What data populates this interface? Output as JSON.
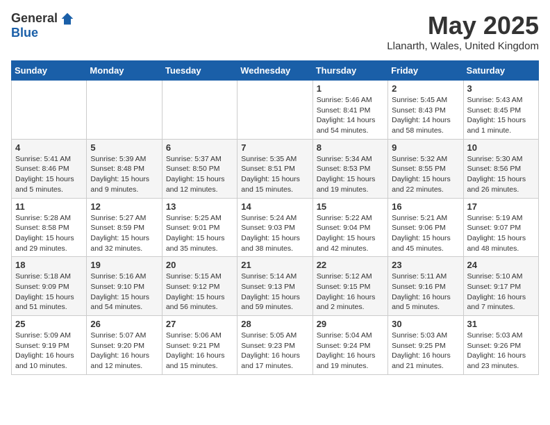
{
  "header": {
    "logo_general": "General",
    "logo_blue": "Blue",
    "month_title": "May 2025",
    "location": "Llanarth, Wales, United Kingdom"
  },
  "weekdays": [
    "Sunday",
    "Monday",
    "Tuesday",
    "Wednesday",
    "Thursday",
    "Friday",
    "Saturday"
  ],
  "weeks": [
    [
      {
        "day": "",
        "info": ""
      },
      {
        "day": "",
        "info": ""
      },
      {
        "day": "",
        "info": ""
      },
      {
        "day": "",
        "info": ""
      },
      {
        "day": "1",
        "info": "Sunrise: 5:46 AM\nSunset: 8:41 PM\nDaylight: 14 hours\nand 54 minutes."
      },
      {
        "day": "2",
        "info": "Sunrise: 5:45 AM\nSunset: 8:43 PM\nDaylight: 14 hours\nand 58 minutes."
      },
      {
        "day": "3",
        "info": "Sunrise: 5:43 AM\nSunset: 8:45 PM\nDaylight: 15 hours\nand 1 minute."
      }
    ],
    [
      {
        "day": "4",
        "info": "Sunrise: 5:41 AM\nSunset: 8:46 PM\nDaylight: 15 hours\nand 5 minutes."
      },
      {
        "day": "5",
        "info": "Sunrise: 5:39 AM\nSunset: 8:48 PM\nDaylight: 15 hours\nand 9 minutes."
      },
      {
        "day": "6",
        "info": "Sunrise: 5:37 AM\nSunset: 8:50 PM\nDaylight: 15 hours\nand 12 minutes."
      },
      {
        "day": "7",
        "info": "Sunrise: 5:35 AM\nSunset: 8:51 PM\nDaylight: 15 hours\nand 15 minutes."
      },
      {
        "day": "8",
        "info": "Sunrise: 5:34 AM\nSunset: 8:53 PM\nDaylight: 15 hours\nand 19 minutes."
      },
      {
        "day": "9",
        "info": "Sunrise: 5:32 AM\nSunset: 8:55 PM\nDaylight: 15 hours\nand 22 minutes."
      },
      {
        "day": "10",
        "info": "Sunrise: 5:30 AM\nSunset: 8:56 PM\nDaylight: 15 hours\nand 26 minutes."
      }
    ],
    [
      {
        "day": "11",
        "info": "Sunrise: 5:28 AM\nSunset: 8:58 PM\nDaylight: 15 hours\nand 29 minutes."
      },
      {
        "day": "12",
        "info": "Sunrise: 5:27 AM\nSunset: 8:59 PM\nDaylight: 15 hours\nand 32 minutes."
      },
      {
        "day": "13",
        "info": "Sunrise: 5:25 AM\nSunset: 9:01 PM\nDaylight: 15 hours\nand 35 minutes."
      },
      {
        "day": "14",
        "info": "Sunrise: 5:24 AM\nSunset: 9:03 PM\nDaylight: 15 hours\nand 38 minutes."
      },
      {
        "day": "15",
        "info": "Sunrise: 5:22 AM\nSunset: 9:04 PM\nDaylight: 15 hours\nand 42 minutes."
      },
      {
        "day": "16",
        "info": "Sunrise: 5:21 AM\nSunset: 9:06 PM\nDaylight: 15 hours\nand 45 minutes."
      },
      {
        "day": "17",
        "info": "Sunrise: 5:19 AM\nSunset: 9:07 PM\nDaylight: 15 hours\nand 48 minutes."
      }
    ],
    [
      {
        "day": "18",
        "info": "Sunrise: 5:18 AM\nSunset: 9:09 PM\nDaylight: 15 hours\nand 51 minutes."
      },
      {
        "day": "19",
        "info": "Sunrise: 5:16 AM\nSunset: 9:10 PM\nDaylight: 15 hours\nand 54 minutes."
      },
      {
        "day": "20",
        "info": "Sunrise: 5:15 AM\nSunset: 9:12 PM\nDaylight: 15 hours\nand 56 minutes."
      },
      {
        "day": "21",
        "info": "Sunrise: 5:14 AM\nSunset: 9:13 PM\nDaylight: 15 hours\nand 59 minutes."
      },
      {
        "day": "22",
        "info": "Sunrise: 5:12 AM\nSunset: 9:15 PM\nDaylight: 16 hours\nand 2 minutes."
      },
      {
        "day": "23",
        "info": "Sunrise: 5:11 AM\nSunset: 9:16 PM\nDaylight: 16 hours\nand 5 minutes."
      },
      {
        "day": "24",
        "info": "Sunrise: 5:10 AM\nSunset: 9:17 PM\nDaylight: 16 hours\nand 7 minutes."
      }
    ],
    [
      {
        "day": "25",
        "info": "Sunrise: 5:09 AM\nSunset: 9:19 PM\nDaylight: 16 hours\nand 10 minutes."
      },
      {
        "day": "26",
        "info": "Sunrise: 5:07 AM\nSunset: 9:20 PM\nDaylight: 16 hours\nand 12 minutes."
      },
      {
        "day": "27",
        "info": "Sunrise: 5:06 AM\nSunset: 9:21 PM\nDaylight: 16 hours\nand 15 minutes."
      },
      {
        "day": "28",
        "info": "Sunrise: 5:05 AM\nSunset: 9:23 PM\nDaylight: 16 hours\nand 17 minutes."
      },
      {
        "day": "29",
        "info": "Sunrise: 5:04 AM\nSunset: 9:24 PM\nDaylight: 16 hours\nand 19 minutes."
      },
      {
        "day": "30",
        "info": "Sunrise: 5:03 AM\nSunset: 9:25 PM\nDaylight: 16 hours\nand 21 minutes."
      },
      {
        "day": "31",
        "info": "Sunrise: 5:03 AM\nSunset: 9:26 PM\nDaylight: 16 hours\nand 23 minutes."
      }
    ]
  ]
}
